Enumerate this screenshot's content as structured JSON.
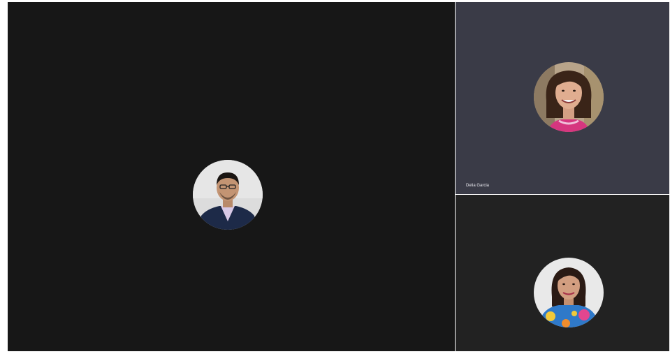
{
  "call": {
    "participants": [
      {
        "id": "main",
        "name": "",
        "avatar_icon": "person-photo-icon"
      },
      {
        "id": "side-top",
        "name": "Delia Garcia",
        "avatar_icon": "person-photo-icon"
      },
      {
        "id": "side-bottom",
        "name": "",
        "avatar_icon": "person-photo-icon"
      }
    ]
  },
  "colors": {
    "main_tile_bg": "#171717",
    "side_top_bg": "#3a3b47",
    "side_bottom_bg": "#222222",
    "name_text": "#e8e8ee"
  }
}
